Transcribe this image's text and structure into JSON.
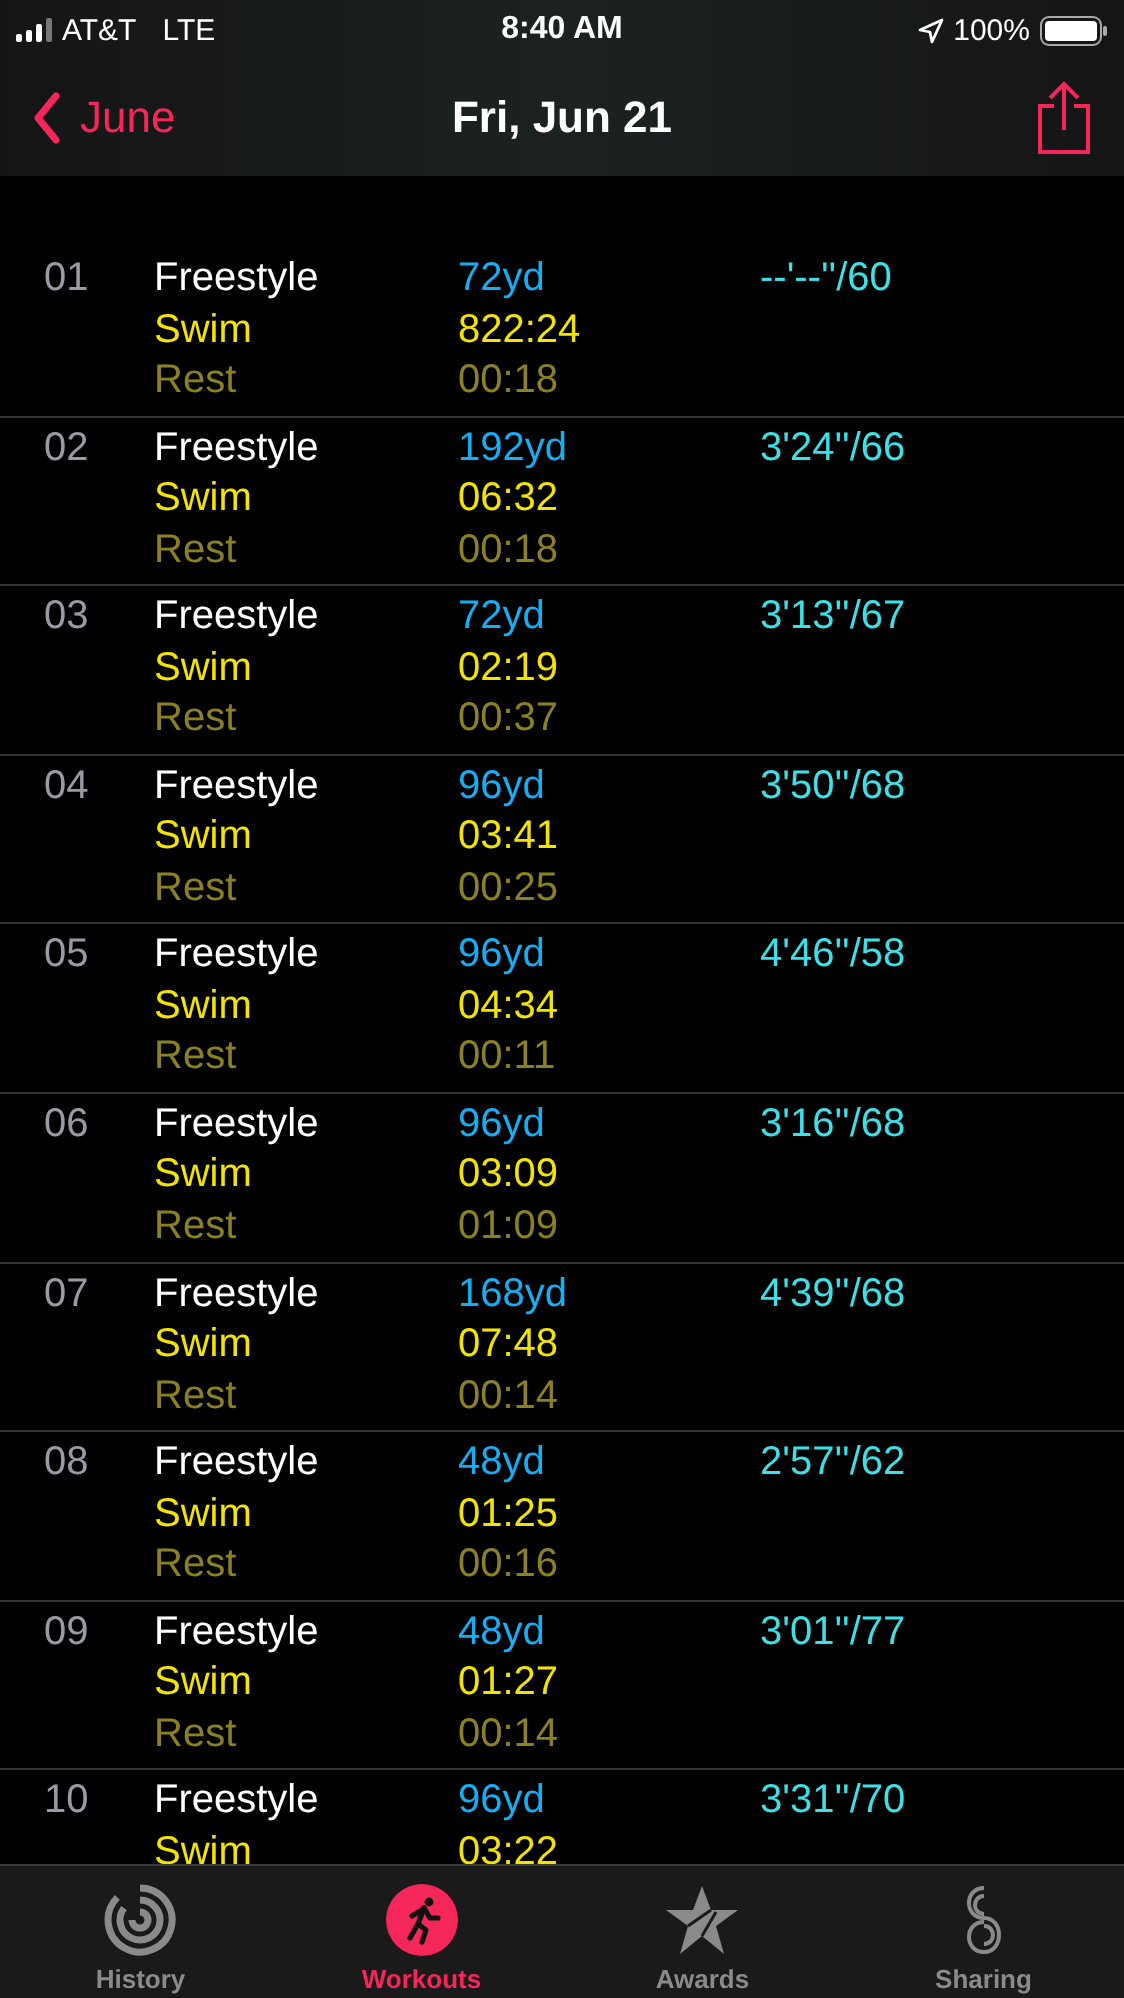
{
  "status_bar": {
    "carrier": "AT&T",
    "network": "LTE",
    "time": "8:40 AM",
    "battery": "100%"
  },
  "nav": {
    "back": "June",
    "title": "Fri, Jun 21"
  },
  "laps": [
    {
      "number": "01",
      "stroke": "Freestyle",
      "distance": "72yd",
      "swim_label": "Swim",
      "swim_time": "822:24",
      "rest_label": "Rest",
      "rest_time": "00:18",
      "pace": "--'--''/60"
    },
    {
      "number": "02",
      "stroke": "Freestyle",
      "distance": "192yd",
      "swim_label": "Swim",
      "swim_time": "06:32",
      "rest_label": "Rest",
      "rest_time": "00:18",
      "pace": "3'24''/66"
    },
    {
      "number": "03",
      "stroke": "Freestyle",
      "distance": "72yd",
      "swim_label": "Swim",
      "swim_time": "02:19",
      "rest_label": "Rest",
      "rest_time": "00:37",
      "pace": "3'13''/67"
    },
    {
      "number": "04",
      "stroke": "Freestyle",
      "distance": "96yd",
      "swim_label": "Swim",
      "swim_time": "03:41",
      "rest_label": "Rest",
      "rest_time": "00:25",
      "pace": "3'50''/68"
    },
    {
      "number": "05",
      "stroke": "Freestyle",
      "distance": "96yd",
      "swim_label": "Swim",
      "swim_time": "04:34",
      "rest_label": "Rest",
      "rest_time": "00:11",
      "pace": "4'46''/58"
    },
    {
      "number": "06",
      "stroke": "Freestyle",
      "distance": "96yd",
      "swim_label": "Swim",
      "swim_time": "03:09",
      "rest_label": "Rest",
      "rest_time": "01:09",
      "pace": "3'16''/68"
    },
    {
      "number": "07",
      "stroke": "Freestyle",
      "distance": "168yd",
      "swim_label": "Swim",
      "swim_time": "07:48",
      "rest_label": "Rest",
      "rest_time": "00:14",
      "pace": "4'39''/68"
    },
    {
      "number": "08",
      "stroke": "Freestyle",
      "distance": "48yd",
      "swim_label": "Swim",
      "swim_time": "01:25",
      "rest_label": "Rest",
      "rest_time": "00:16",
      "pace": "2'57''/62"
    },
    {
      "number": "09",
      "stroke": "Freestyle",
      "distance": "48yd",
      "swim_label": "Swim",
      "swim_time": "01:27",
      "rest_label": "Rest",
      "rest_time": "00:14",
      "pace": "3'01''/77"
    },
    {
      "number": "10",
      "stroke": "Freestyle",
      "distance": "96yd",
      "swim_label": "Swim",
      "swim_time": "03:22",
      "pace": "3'31''/70"
    }
  ],
  "tabs": [
    {
      "label": "History",
      "kind": "rings",
      "selected": false
    },
    {
      "label": "Workouts",
      "kind": "runner",
      "selected": true
    },
    {
      "label": "Awards",
      "kind": "star",
      "selected": false
    },
    {
      "label": "Sharing",
      "kind": "sharing",
      "selected": false
    }
  ]
}
